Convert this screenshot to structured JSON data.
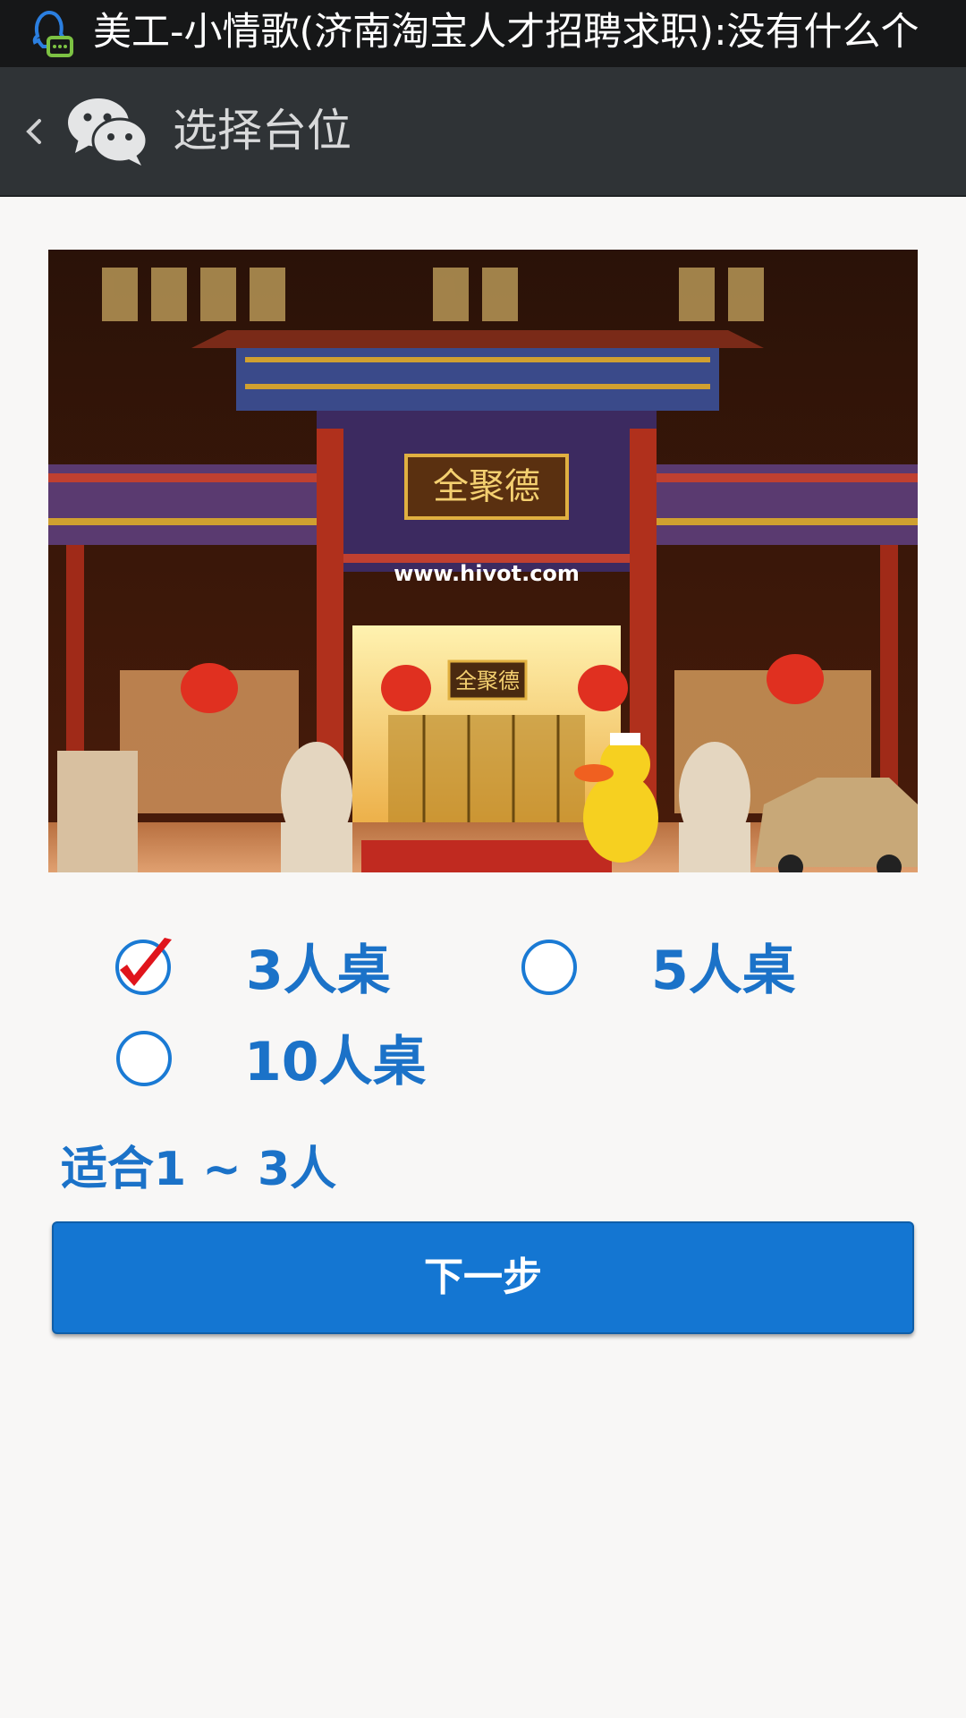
{
  "status_bar": {
    "notification_text": "美工-小情歌(济南淘宝人才招聘求职):没有什么个",
    "icon": "qq-icon"
  },
  "app_bar": {
    "back_icon": "chevron-left-icon",
    "app_icon": "wechat-icon",
    "title": "选择台位"
  },
  "photo": {
    "sign_main": "全聚德",
    "sign_url": "www.hivot.com",
    "sign_door": "全聚德"
  },
  "table_options": [
    {
      "label": "3人桌",
      "selected": true
    },
    {
      "label": "5人桌",
      "selected": false
    },
    {
      "label": "10人桌",
      "selected": false
    }
  ],
  "hint": "适合1 ~ 3人",
  "next_button": "下一步",
  "colors": {
    "accent": "#1476d2",
    "text_blue": "#1b72c8",
    "status_bar": "#161718",
    "app_bar": "#2f3336",
    "background": "#f8f7f6",
    "check": "#e0151c"
  }
}
